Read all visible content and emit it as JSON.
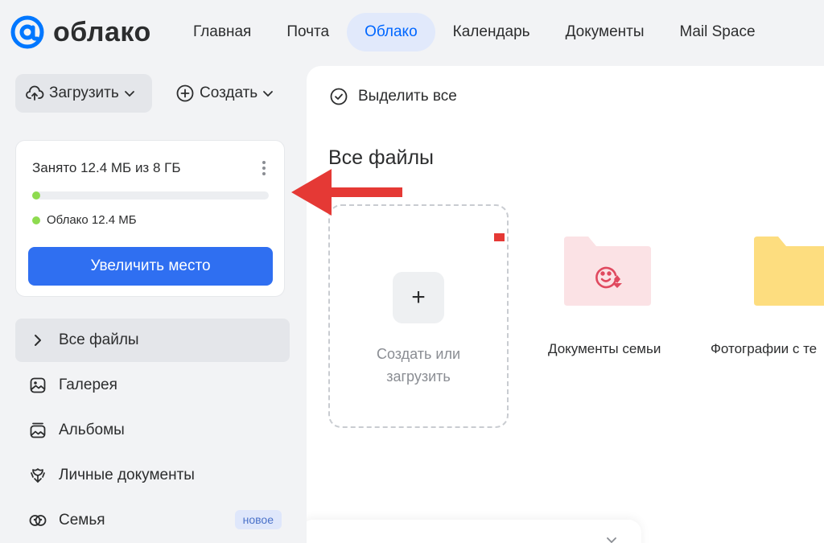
{
  "brand": {
    "name": "облако"
  },
  "nav": {
    "items": [
      {
        "label": "Главная"
      },
      {
        "label": "Почта"
      },
      {
        "label": "Облако"
      },
      {
        "label": "Календарь"
      },
      {
        "label": "Документы"
      },
      {
        "label": "Mail Space"
      }
    ],
    "active_index": 2
  },
  "sidebar": {
    "upload_label": "Загрузить",
    "create_label": "Создать",
    "storage": {
      "title": "Занято 12.4 МБ из 8 ГБ",
      "used_fraction": 0.0015,
      "legend": "Облако 12.4 МБ",
      "button": "Увеличить место"
    },
    "items": [
      {
        "label": "Все файлы",
        "icon": "chevron-right-icon"
      },
      {
        "label": "Галерея",
        "icon": "gallery-icon"
      },
      {
        "label": "Альбомы",
        "icon": "albums-icon"
      },
      {
        "label": "Личные документы",
        "icon": "documents-icon"
      },
      {
        "label": "Семья",
        "icon": "family-icon",
        "badge": "новое"
      }
    ]
  },
  "main": {
    "select_all": "Выделить все",
    "title": "Все файлы",
    "create_card": {
      "line1": "Создать или",
      "line2": "загрузить"
    },
    "folders": [
      {
        "label": "Документы семьи",
        "color": "#fbe2e5"
      },
      {
        "label": "Фотографии с те",
        "color": "#fddd7f"
      }
    ]
  },
  "colors": {
    "accent": "#2f6ff1",
    "storage_green": "#8edb4f",
    "annotation_red": "#e53935"
  }
}
